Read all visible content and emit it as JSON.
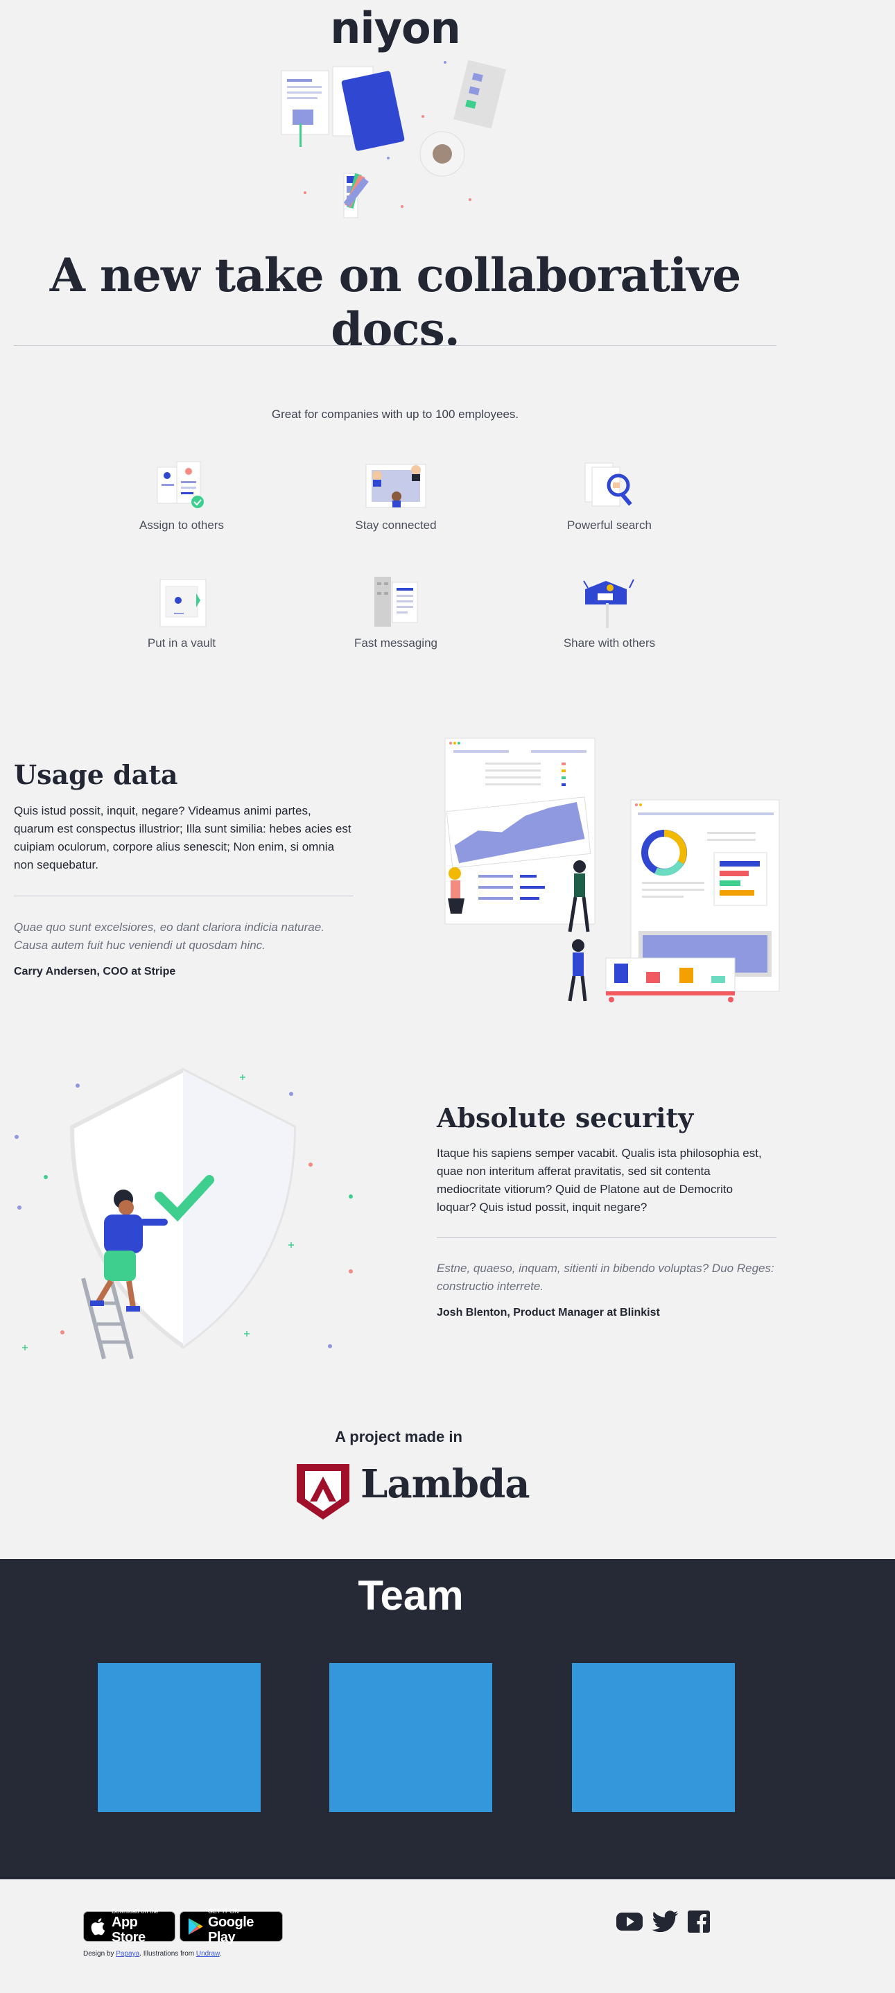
{
  "header": {
    "logo": "niyon"
  },
  "hero": {
    "title": "A new take on collaborative docs."
  },
  "features": {
    "tagline": "Great for companies with up to 100 employees.",
    "items": [
      {
        "label": "Assign to others",
        "icon": "assign-icon"
      },
      {
        "label": "Stay connected",
        "icon": "connected-icon"
      },
      {
        "label": "Powerful search",
        "icon": "search-icon"
      },
      {
        "label": "Put in a vault",
        "icon": "vault-icon"
      },
      {
        "label": "Fast messaging",
        "icon": "messaging-icon"
      },
      {
        "label": "Share with others",
        "icon": "share-icon"
      }
    ]
  },
  "usage": {
    "title": "Usage data",
    "body": "Quis istud possit, inquit, negare? Videamus animi partes, quarum est conspectus illustrior; Illa sunt similia: hebes acies est cuipiam oculorum, corpore alius senescit; Non enim, si omnia non sequebatur.",
    "quote": "Quae quo sunt excelsiores, eo dant clariora indicia naturae. Causa autem fuit huc veniendi ut quosdam hinc.",
    "author": "Carry Andersen, COO at Stripe"
  },
  "security": {
    "title": "Absolute security",
    "body": "Itaque his sapiens semper vacabit. Qualis ista philosophia est, quae non interitum afferat pravitatis, sed sit contenta mediocritate vitiorum? Quid de Platone aut de Democrito loquar? Quis istud possit, inquit negare?",
    "quote": "Estne, quaeso, inquam, sitienti in bibendo voluptas? Duo Reges: constructio interrete.",
    "author": "Josh Blenton, Product Manager at Blinkist"
  },
  "project": {
    "made_in": "A project made in",
    "org": "Lambda"
  },
  "team": {
    "title": "Team",
    "members": 3
  },
  "footer": {
    "appstore": {
      "small": "Download on the",
      "big": "App Store"
    },
    "googleplay": {
      "small": "GET IT ON",
      "big": "Google Play"
    },
    "credits": {
      "prefix": "Design by ",
      "designer": "Papaya",
      "middle": ". Illustrations from ",
      "source": "Undraw",
      "suffix": "."
    },
    "social": [
      "youtube-icon",
      "twitter-icon",
      "facebook-icon"
    ]
  },
  "colors": {
    "dark": "#232733",
    "team_bg": "#262a36",
    "accent_blue": "#3597db",
    "brand_blue": "#2f47d1",
    "lambda_red": "#a0102b"
  }
}
